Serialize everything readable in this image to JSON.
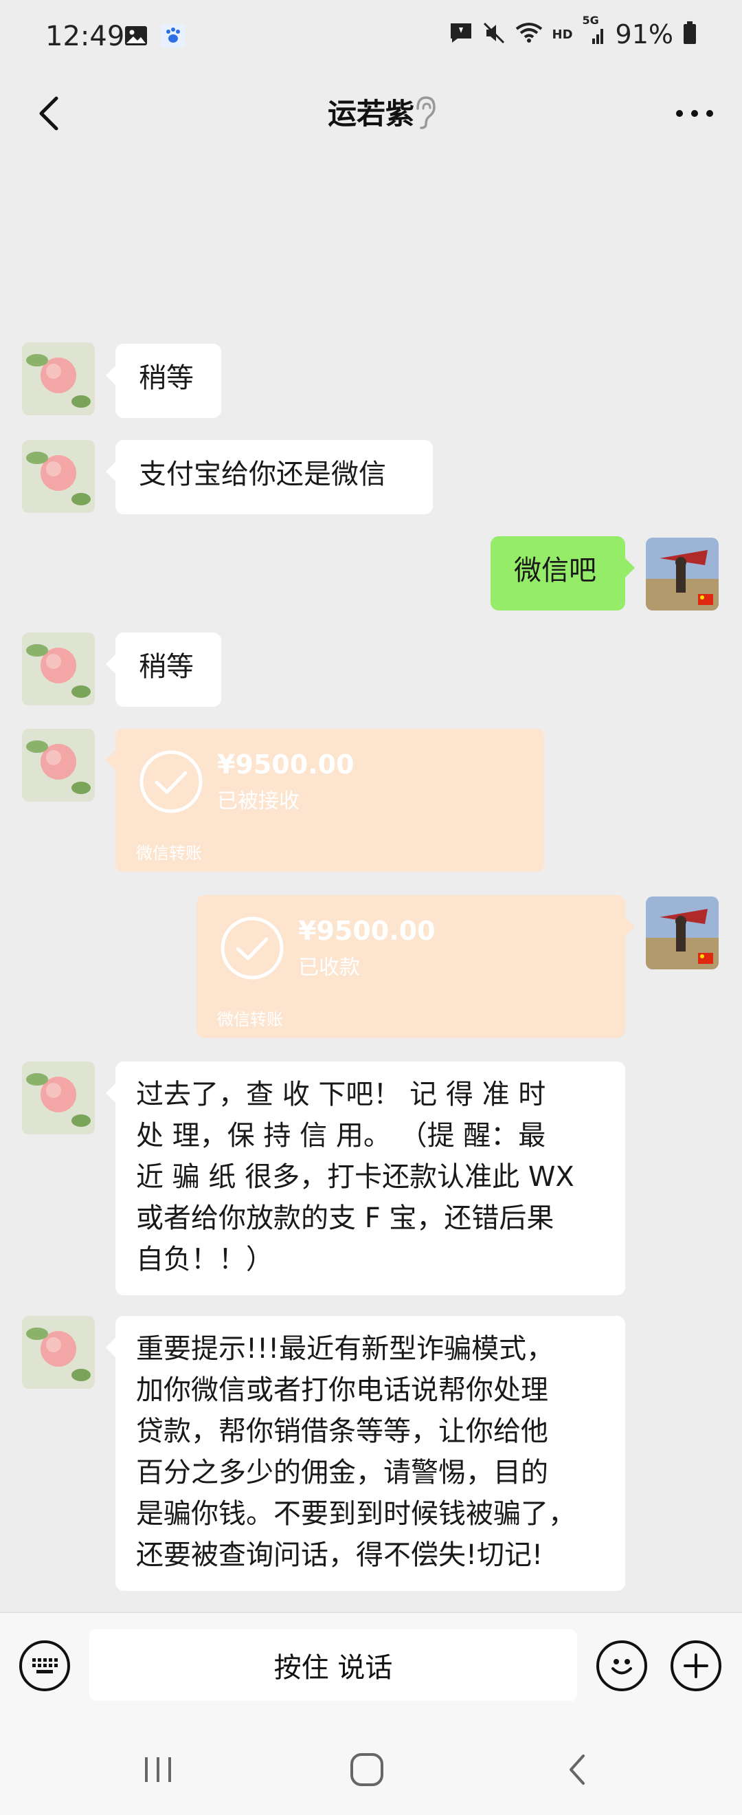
{
  "status_bar": {
    "time": "12:49",
    "battery": "91%",
    "network_hd": "HD",
    "network_5g": "5G",
    "icons": [
      "image-icon",
      "baidu-paw-icon",
      "chat-notification-icon",
      "mute-icon",
      "wifi-icon",
      "signal-icon",
      "battery-icon"
    ]
  },
  "header": {
    "title": "运若紫",
    "icons": [
      "back-arrow-icon",
      "ear-icon",
      "more-dots-icon"
    ]
  },
  "messages": [
    {
      "side": "left",
      "type": "text",
      "text": "稍等"
    },
    {
      "side": "left",
      "type": "text",
      "text": "支付宝给你还是微信"
    },
    {
      "side": "right",
      "type": "text",
      "text": "微信吧"
    },
    {
      "side": "left",
      "type": "text",
      "text": "稍等"
    },
    {
      "side": "left",
      "type": "transfer",
      "amount": "¥9500.00",
      "status": "已被接收",
      "label": "微信转账"
    },
    {
      "side": "right",
      "type": "transfer",
      "amount": "¥9500.00",
      "status": "已收款",
      "label": "微信转账"
    },
    {
      "side": "left",
      "type": "text",
      "lines": [
        "过去了，查 收 下吧！ 记 得 准 时",
        "处 理，保 持 信 用。 （提 醒：最",
        "近 骗 纸 很多，打卡还款认准此 WX",
        "或者给你放款的支 F 宝，还错后果",
        "自负！！）"
      ]
    },
    {
      "side": "left",
      "type": "text",
      "lines": [
        "重要提示!!!最近有新型诈骗模式，",
        "加你微信或者打你电话说帮你处理",
        "贷款，帮你销借条等等，让你给他",
        "百分之多少的佣金，请警惕，目的",
        "是骗你钱。不要到到时候钱被骗了，",
        "还要被查询问话，得不偿失!切记!"
      ]
    }
  ],
  "input_bar": {
    "hold_to_talk": "按住 说话",
    "icons": [
      "keyboard-icon",
      "emoji-icon",
      "plus-icon"
    ]
  },
  "nav_bar": {
    "icons": [
      "recents-icon",
      "home-icon",
      "nav-back-icon"
    ]
  },
  "colors": {
    "background": "#ededed",
    "sent_bubble": "#95ec69",
    "transfer_bubble": "#fce4cf"
  }
}
